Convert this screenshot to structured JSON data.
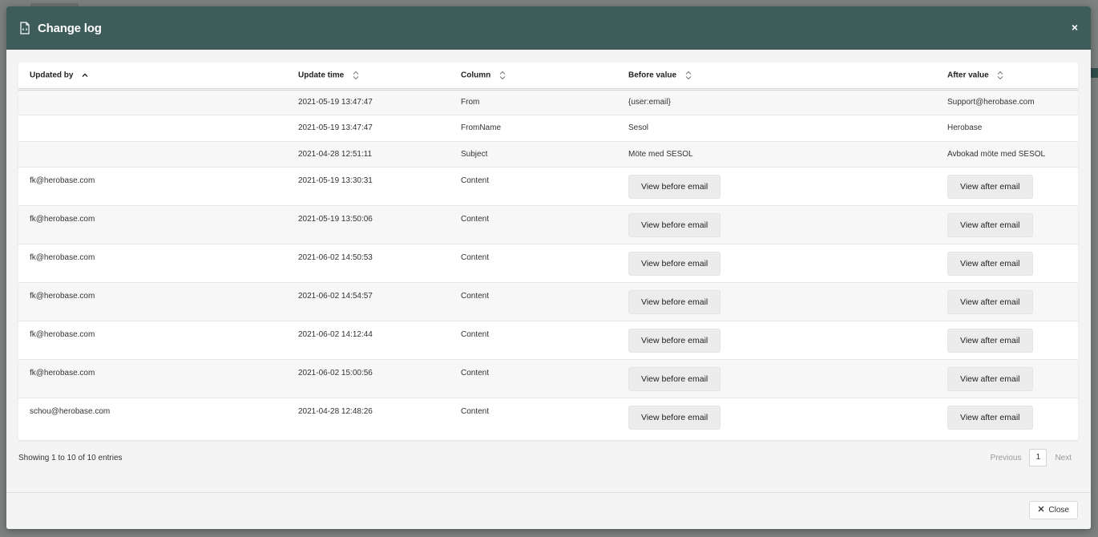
{
  "modal": {
    "title": "Change log",
    "close_x": "×",
    "close_label": "Close"
  },
  "columns": [
    {
      "label": "Updated by",
      "sort": "asc"
    },
    {
      "label": "Update time",
      "sort": "both"
    },
    {
      "label": "Column",
      "sort": "both"
    },
    {
      "label": "Before value",
      "sort": "both"
    },
    {
      "label": "After value",
      "sort": "both"
    }
  ],
  "rows": [
    {
      "updated_by": "",
      "update_time": "2021-05-19 13:47:47",
      "column": "From",
      "before": "{user:email}",
      "after": "Support@herobase.com"
    },
    {
      "updated_by": "",
      "update_time": "2021-05-19 13:47:47",
      "column": "FromName",
      "before": "Sesol",
      "after": "Herobase"
    },
    {
      "updated_by": "",
      "update_time": "2021-04-28 12:51:11",
      "column": "Subject",
      "before": "Möte med SESOL",
      "after": "Avbokad möte med SESOL"
    },
    {
      "updated_by": "fk@herobase.com",
      "update_time": "2021-05-19 13:30:31",
      "column": "Content",
      "before": "View before email",
      "after": "View after email"
    },
    {
      "updated_by": "fk@herobase.com",
      "update_time": "2021-05-19 13:50:06",
      "column": "Content",
      "before": "View before email",
      "after": "View after email"
    },
    {
      "updated_by": "fk@herobase.com",
      "update_time": "2021-06-02 14:50:53",
      "column": "Content",
      "before": "View before email",
      "after": "View after email"
    },
    {
      "updated_by": "fk@herobase.com",
      "update_time": "2021-06-02 14:54:57",
      "column": "Content",
      "before": "View before email",
      "after": "View after email"
    },
    {
      "updated_by": "fk@herobase.com",
      "update_time": "2021-06-02 14:12:44",
      "column": "Content",
      "before": "View before email",
      "after": "View after email"
    },
    {
      "updated_by": "fk@herobase.com",
      "update_time": "2021-06-02 15:00:56",
      "column": "Content",
      "before": "View before email",
      "after": "View after email"
    },
    {
      "updated_by": "schou@herobase.com",
      "update_time": "2021-04-28 12:48:26",
      "column": "Content",
      "before": "View before email",
      "after": "View after email"
    }
  ],
  "table_info": "Showing 1 to 10 of 10 entries",
  "pagination": {
    "previous": "Previous",
    "current_page": "1",
    "next": "Next"
  },
  "colors": {
    "header_bg": "#3d5c5a",
    "modal_bg": "#f4f4f4"
  },
  "icons": {
    "title_icon": "document-icon",
    "close_icon": "x-icon",
    "sort_asc": "caret-up-icon",
    "sort_both": "sort-updown-icon"
  }
}
